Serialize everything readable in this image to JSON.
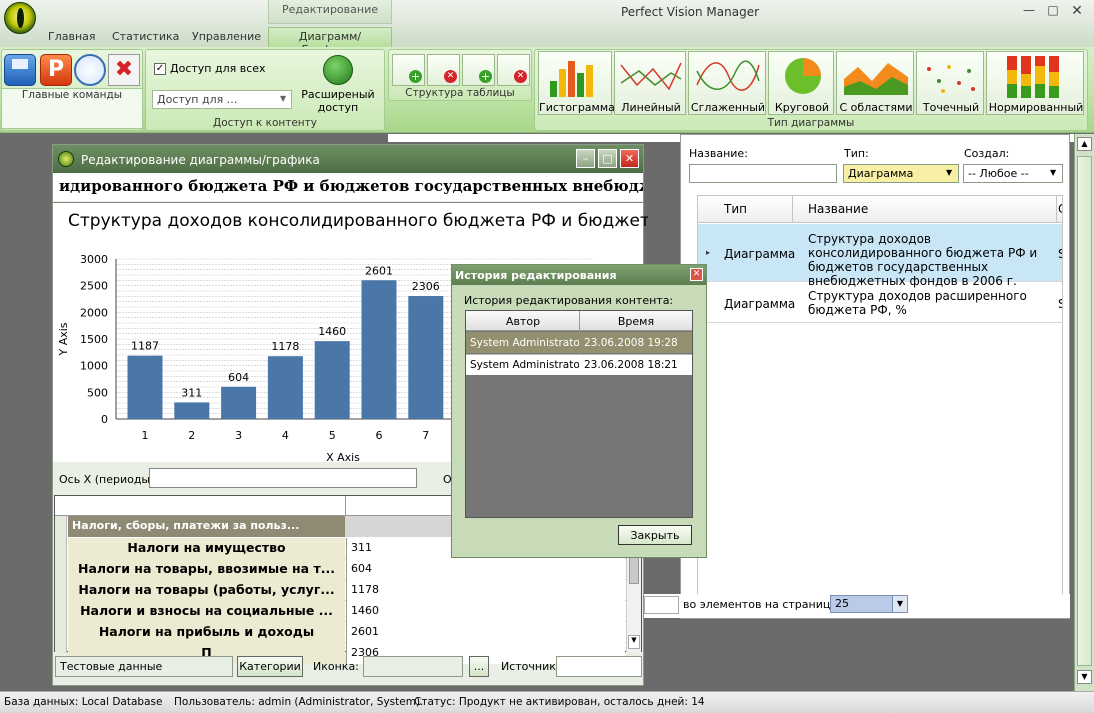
{
  "window": {
    "title": "Perfect Vision Manager",
    "context_tab": "Редактирование"
  },
  "tabs": [
    "Главная",
    "Статистика",
    "Управление",
    "Диаграмм/Графиков"
  ],
  "ribbon": {
    "main_commands_label": "Главные команды",
    "access_all_label": "Доступ для всех",
    "access_for_placeholder": "Доступ для ...",
    "extended_access_label": "Расширеный доступ",
    "content_access_group": "Доступ к контенту",
    "table_structure_group": "Структура таблицы",
    "chart_type_group": "Тип диаграммы",
    "chart_types": [
      "Гистограмма",
      "Линейный",
      "Сглаженный",
      "Круговой",
      "С областями",
      "Точечный",
      "Нормированный"
    ]
  },
  "right_panel": {
    "name_label": "Название:",
    "type_label": "Тип:",
    "type_value": "Диаграмма",
    "created_label": "Создал:",
    "created_value": "-- Любое --",
    "col_type": "Тип",
    "col_name": "Название",
    "col_extra": "С",
    "rows": [
      {
        "type": "Диаграмма",
        "name": "Структура доходов консолидированного бюджета РФ и бюджетов государственных внебюджетных фондов в 2006 г.",
        "extra": "S"
      },
      {
        "type": "Диаграмма",
        "name": "Структура доходов расширенного бюджета РФ, %",
        "extra": "S"
      }
    ],
    "per_page_label": "во элементов на странице:",
    "per_page_value": "25"
  },
  "editor": {
    "title": "Редактирование диаграммы/графика",
    "heading": "идированного бюджета РФ и бюджетов государственных внебюдж",
    "x_axis_label_field": "Ось X (периоды):",
    "other_label": "О",
    "grid_header": "Налоги, сборы, платежи за польз...",
    "grid_rows": [
      {
        "name": "Налоги на имущество",
        "value": "311"
      },
      {
        "name": "Налоги на товары, ввозимые на т...",
        "value": "604"
      },
      {
        "name": "Налоги на товары (работы, услуг...",
        "value": "1178"
      },
      {
        "name": "Налоги и взносы на социальные ...",
        "value": "1460"
      },
      {
        "name": "Налоги на прибыль и доходы",
        "value": "2601"
      },
      {
        "name": "П",
        "value": "2306"
      }
    ],
    "test_data": "Тестовые данные",
    "categories_button": "Категории",
    "icon_label": "Иконка:",
    "browse_button": "...",
    "source_label": "Источник:"
  },
  "chart_data": {
    "type": "bar",
    "title": "Структура доходов консолидированного бюджета РФ и бюджетов г",
    "xlabel": "X Axis",
    "ylabel": "Y Axis",
    "categories": [
      "1",
      "2",
      "3",
      "4",
      "5",
      "6",
      "7"
    ],
    "values": [
      1187,
      311,
      604,
      1178,
      1460,
      2601,
      2306
    ],
    "ylim": [
      0,
      3000
    ],
    "yticks": [
      "0",
      "500",
      "1000",
      "1500",
      "2000",
      "2500",
      "3000"
    ],
    "bar_color": "#4a76a8",
    "grid": true
  },
  "dialog": {
    "title": "История редактирования",
    "subtitle": "История редактирования контента:",
    "col_author": "Автор",
    "col_time": "Время",
    "rows": [
      {
        "author": "System Administrator",
        "time": "23.06.2008 19:28"
      },
      {
        "author": "System Administrator",
        "time": "23.06.2008 18:21"
      }
    ],
    "close_button": "Закрыть"
  },
  "statusbar": {
    "db": "База данных: Local Database",
    "user": "Пользователь: admin (Administrator, System).",
    "status": "Статус: Продукт не активирован, осталось дней: 14"
  }
}
